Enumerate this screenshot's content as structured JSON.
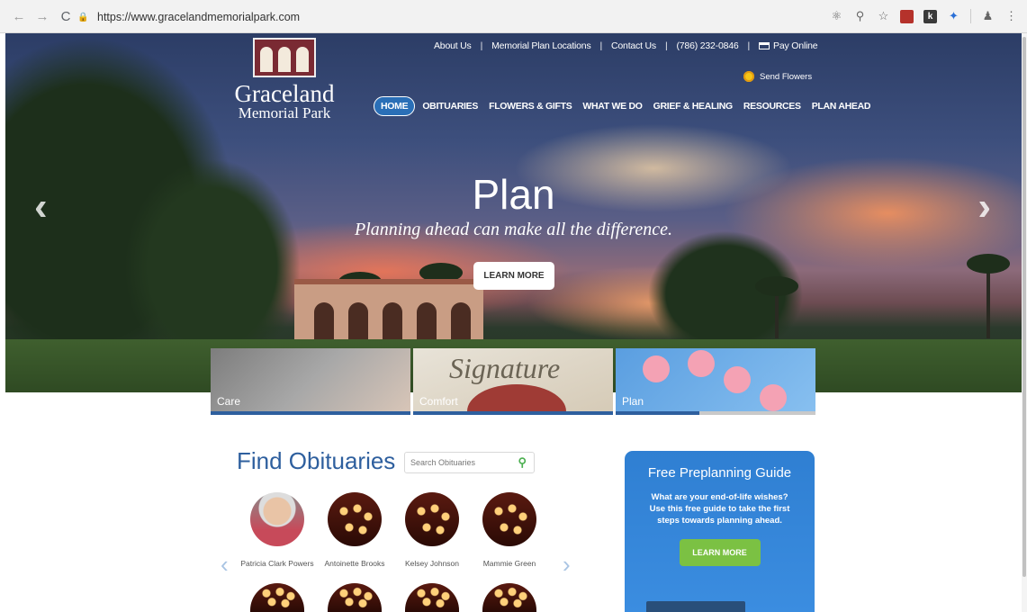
{
  "browser": {
    "url": "https://www.gracelandmemorialpark.com",
    "back_icon": "←",
    "forward_icon": "→",
    "reload_icon": "C",
    "extensions": [
      "translate-icon",
      "zoom-icon",
      "star-icon",
      "pdf-icon",
      "k-icon",
      "dropbox-icon",
      "profile-icon",
      "menu-icon"
    ]
  },
  "site": {
    "logo_name": "Graceland",
    "logo_sub": "Memorial Park",
    "top_links": [
      "About Us",
      "Memorial Plan Locations",
      "Contact Us",
      "(786) 232-0846",
      "Pay Online"
    ],
    "send_flowers": "Send Flowers",
    "nav": [
      "HOME",
      "OBITUARIES",
      "FLOWERS & GIFTS",
      "WHAT WE DO",
      "GRIEF & HEALING",
      "RESOURCES",
      "PLAN AHEAD"
    ]
  },
  "hero": {
    "title": "Plan",
    "subtitle": "Planning ahead can make all the difference.",
    "button": "LEARN MORE",
    "prev": "‹",
    "next": "›"
  },
  "tiles": [
    {
      "label": "Care"
    },
    {
      "label": "Comfort",
      "script": "Signature"
    },
    {
      "label": "Plan"
    }
  ],
  "obituaries": {
    "title": "Find Obituaries",
    "search_placeholder": "Search Obituaries",
    "prev": "‹",
    "next": "›",
    "people": [
      "Patricia Clark Powers",
      "Antoinette Brooks",
      "Kelsey Johnson",
      "Mammie Green"
    ]
  },
  "guide": {
    "title": "Free Preplanning Guide",
    "text": "What are your end-of-life wishes? Use this free guide to take the first steps towards planning ahead.",
    "button": "LEARN MORE"
  },
  "colors": {
    "accent": "#2e5f9e",
    "nav_home": "#2a6fb7",
    "guide_bg": "#2f7fd2",
    "green": "#7bc143"
  }
}
